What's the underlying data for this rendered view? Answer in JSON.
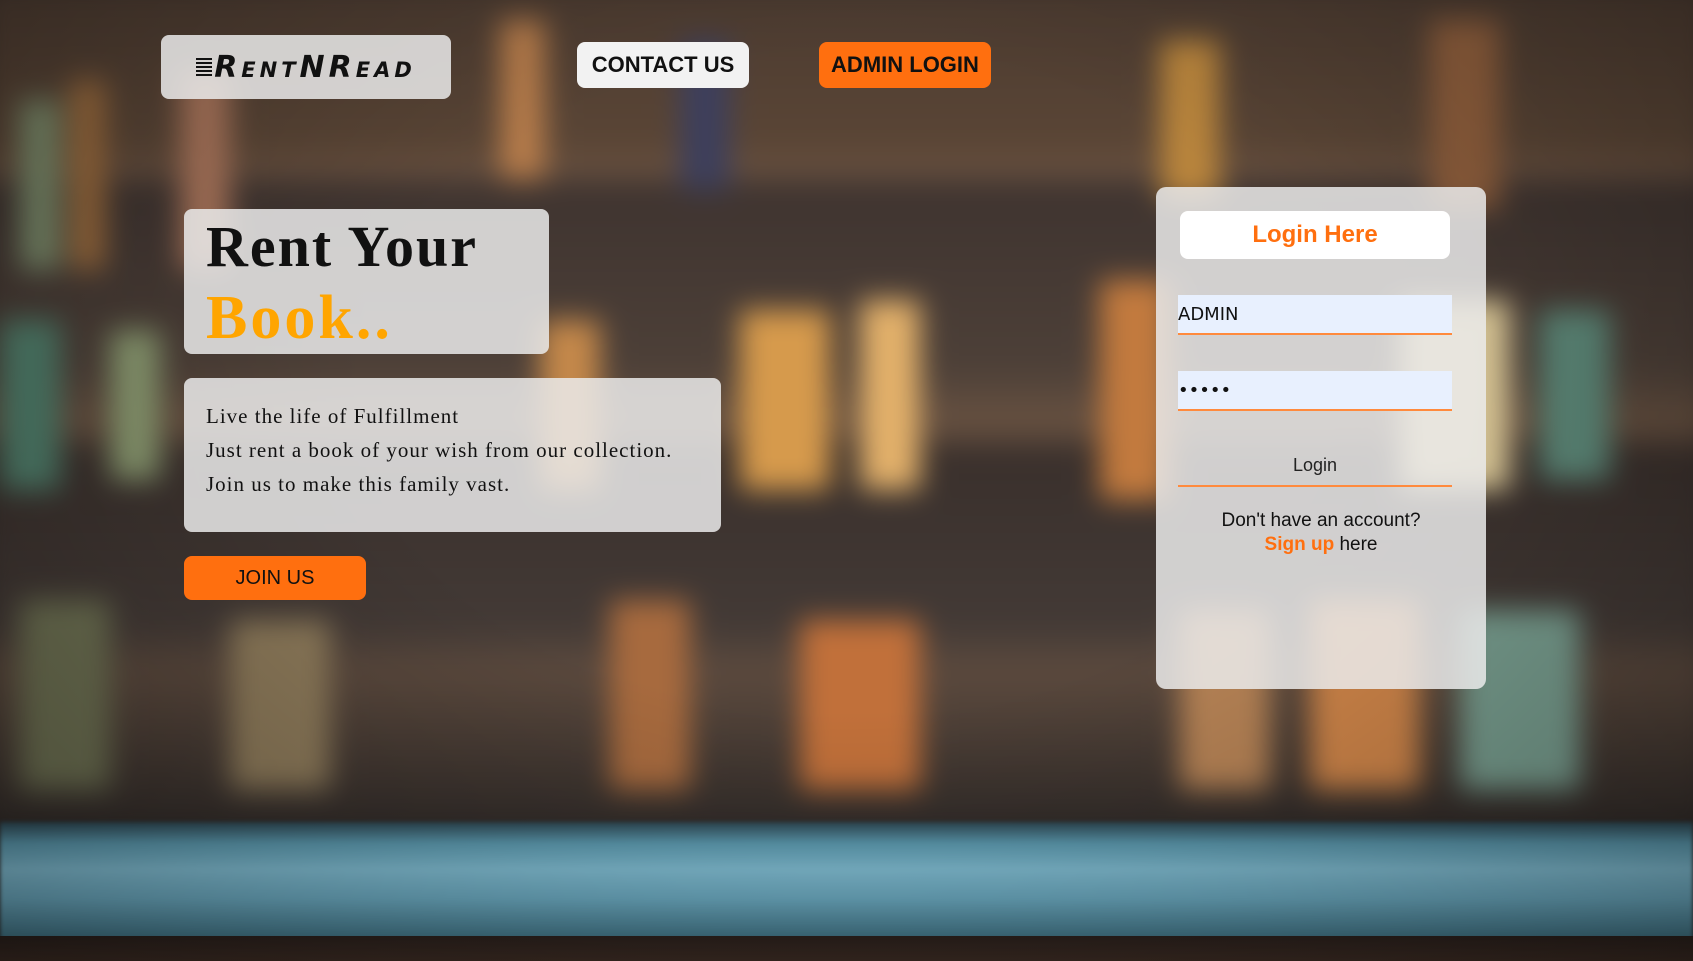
{
  "header": {
    "logo_text": "RentNRead",
    "contact_label": "CONTACT US",
    "admin_login_label": "ADMIN LOGIN"
  },
  "hero": {
    "title_line1": "Rent Your",
    "title_line2": "Book..",
    "description": [
      "Live the life of Fulfillment",
      "Just rent a book of your wish from our collection.",
      "Join us to make this family vast."
    ],
    "join_label": "JOIN US"
  },
  "login": {
    "title": "Login Here",
    "username_value": "ADMIN",
    "password_value": "•••••",
    "submit_label": "Login",
    "signup_prompt": "Don't have an account?",
    "signup_link": "Sign up",
    "signup_suffix": " here"
  },
  "colors": {
    "accent": "#ff6f0f",
    "title_highlight": "#ffa500",
    "panel": "#ebebeb"
  }
}
